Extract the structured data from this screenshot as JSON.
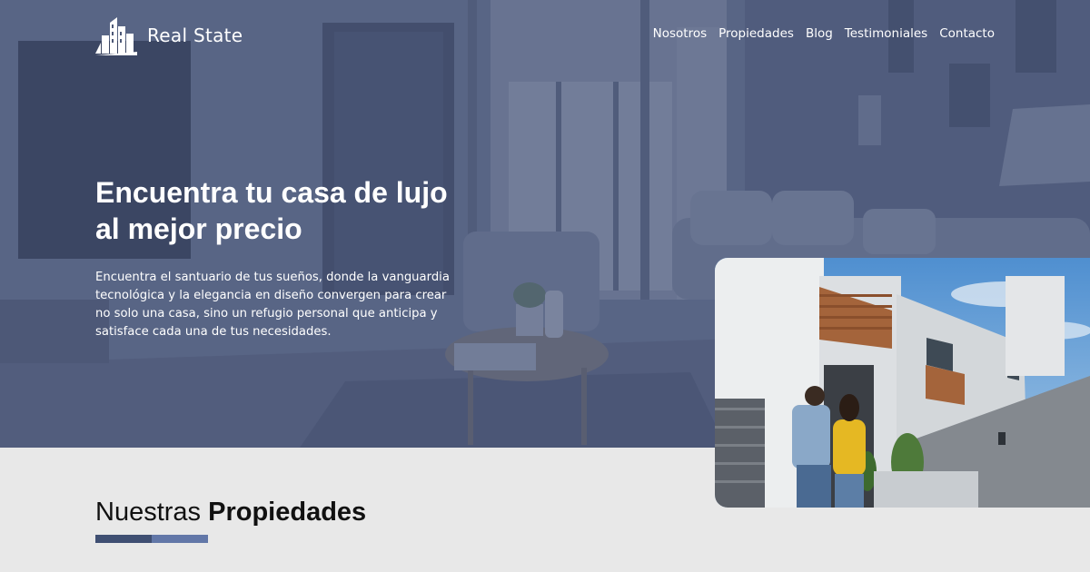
{
  "brand": {
    "name": "Real State",
    "logo_icon": "buildings-icon"
  },
  "nav": {
    "items": [
      {
        "label": "Nosotros"
      },
      {
        "label": "Propiedades"
      },
      {
        "label": "Blog"
      },
      {
        "label": "Testimoniales"
      },
      {
        "label": "Contacto"
      }
    ]
  },
  "hero": {
    "title_line1": "Encuentra tu casa de lujo",
    "title_line2": "al mejor precio",
    "description": "Encuentra el santuario de tus sueños, donde la vanguardia tecnológica y la elegancia en diseño convergen para crear no solo una casa, sino un refugio personal que anticipa y satisface cada una de tus necesidades.",
    "background_image": "living-room-photo",
    "feature_image": "couple-in-front-of-modern-house-photo"
  },
  "section": {
    "title_light": "Nuestras",
    "title_bold": "Propiedades"
  },
  "colors": {
    "hero_overlay": "#48567a",
    "page_background": "#e8e8e8",
    "underline_dark": "#3f4f72",
    "underline_light": "#6277a8",
    "text_on_hero": "#ffffff",
    "section_title": "#111111"
  }
}
